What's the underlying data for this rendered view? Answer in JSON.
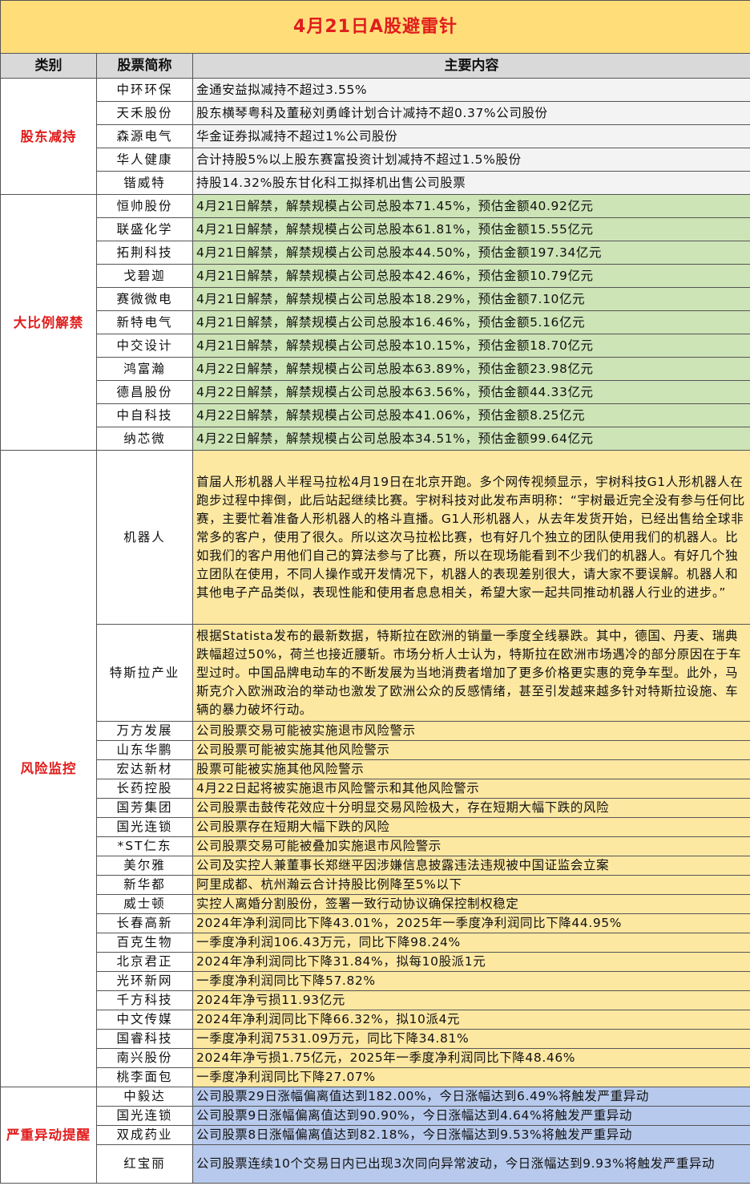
{
  "title": "4月21日A股避雷针",
  "headers": {
    "category": "类别",
    "name": "股票简称",
    "content": "主要内容"
  },
  "sections": [
    {
      "category": "股东减持",
      "theme": "gray",
      "rows": [
        {
          "name": "中环环保",
          "content": "金通安益拟减持不超过3.55%",
          "h": 29
        },
        {
          "name": "天禾股份",
          "content": "股东横琴粤科及董秘刘勇峰计划合计减持不超0.37%公司股份",
          "h": 29
        },
        {
          "name": "森源电气",
          "content": "华金证券拟减持不超过1%公司股份",
          "h": 29
        },
        {
          "name": "华人健康",
          "content": "合计持股5%以上股东赛富投资计划减持不超过1.5%股份",
          "h": 29
        },
        {
          "name": "锴威特",
          "content": "持股14.32%股东甘化科工拟择机出售公司股票",
          "h": 29
        }
      ]
    },
    {
      "category": "大比例解禁",
      "theme": "green",
      "rows": [
        {
          "name": "恒帅股份",
          "content": "4月21日解禁，解禁规模占公司总股本71.45%，预估金额40.92亿元",
          "h": 29
        },
        {
          "name": "联盛化学",
          "content": "4月21日解禁，解禁规模占公司总股本61.81%，预估金额15.55亿元",
          "h": 29
        },
        {
          "name": "拓荆科技",
          "content": "4月21日解禁，解禁规模占公司总股本44.50%，预估金额197.34亿元",
          "h": 29
        },
        {
          "name": "戈碧迦",
          "content": "4月21日解禁，解禁规模占公司总股本42.46%，预估金额10.79亿元",
          "h": 29
        },
        {
          "name": "赛微微电",
          "content": "4月21日解禁，解禁规模占公司总股本18.29%，预估金额7.10亿元",
          "h": 29
        },
        {
          "name": "新特电气",
          "content": "4月21日解禁，解禁规模占公司总股本16.46%，预估金额5.16亿元",
          "h": 29
        },
        {
          "name": "中交设计",
          "content": "4月21日解禁，解禁规模占公司总股本10.15%，预估金额18.70亿元",
          "h": 29
        },
        {
          "name": "鸿富瀚",
          "content": "4月22日解禁，解禁规模占公司总股本63.89%，预估金额23.98亿元",
          "h": 29
        },
        {
          "name": "德昌股份",
          "content": "4月22日解禁，解禁规模占公司总股本63.56%，预估金额44.33亿元",
          "h": 29
        },
        {
          "name": "中自科技",
          "content": "4月22日解禁，解禁规模占公司总股本41.06%，预估金额8.25亿元",
          "h": 29
        },
        {
          "name": "纳芯微",
          "content": "4月22日解禁，解禁规模占公司总股本34.51%，预估金额99.64亿元",
          "h": 29
        }
      ]
    },
    {
      "category": "风险监控",
      "theme": "yellow",
      "rows": [
        {
          "name": "机器人",
          "content": "首届人形机器人半程马拉松4月19日在北京开跑。多个网传视频显示，宇树科技G1人形机器人在跑步过程中摔倒，此后站起继续比赛。宇树科技对此发布声明称：“宇树最近完全没有参与任何比赛，主要忙着准备人形机器人的格斗直播。G1人形机器人，从去年发货开始，已经出售给全球非常多的客户，使用了很久。所以这次马拉松比赛，也有好几个独立的团队使用我们的机器人。比如我们的客户用他们自己的算法参与了比赛，所以在现场能看到不少我们的机器人。有好几个独立团队在使用，不同人操作或开发情况下，机器人的表现差别很大，请大家不要误解。机器人和其他电子产品类似，表现性能和使用者息息相关，希望大家一起共同推动机器人行业的进步。”",
          "h": 217,
          "wrap": true
        },
        {
          "name": "特斯拉产业",
          "content": "根据Statista发布的最新数据，特斯拉在欧洲的销量一季度全线暴跌。其中，德国、丹麦、瑞典跌幅超过50%，荷兰也接近腰斩。市场分析人士认为，特斯拉在欧洲市场遇冷的部分原因在于车型过时。中国品牌电动车的不断发展为当地消费者增加了更多价格更实惠的竞争车型。此外，马斯克介入欧洲政治的举动也激发了欧洲公众的反感情绪，甚至引发越来越多针对特斯拉设施、车辆的暴力破坏行动。",
          "h": 121,
          "wrap": true
        },
        {
          "name": "万方发展",
          "content": "公司股票交易可能被实施退市风险警示",
          "h": 24
        },
        {
          "name": "山东华鹏",
          "content": "公司股票可能被实施其他风险警示",
          "h": 24
        },
        {
          "name": "宏达新材",
          "content": "股票可能被实施其他风险警示",
          "h": 24
        },
        {
          "name": "长药控股",
          "content": "4月22日起将被实施退市风险警示和其他风险警示",
          "h": 24
        },
        {
          "name": "国芳集团",
          "content": "公司股票击鼓传花效应十分明显交易风险极大，存在短期大幅下跌的风险",
          "h": 24
        },
        {
          "name": "国光连锁",
          "content": "公司股票存在短期大幅下跌的风险",
          "h": 24
        },
        {
          "name": "*ST仁东",
          "content": "公司股票交易可能被叠加实施退市风险警示",
          "h": 24
        },
        {
          "name": "美尔雅",
          "content": "公司及实控人兼董事长郑继平因涉嫌信息披露违法违规被中国证监会立案",
          "h": 24
        },
        {
          "name": "新华都",
          "content": "阿里成都、杭州瀚云合计持股比例降至5%以下",
          "h": 24
        },
        {
          "name": "威士顿",
          "content": "实控人离婚分割股份，签署一致行动协议确保控制权稳定",
          "h": 24
        },
        {
          "name": "长春高新",
          "content": "2024年净利润同比下降43.01%，2025年一季度净利润同比下降44.95%",
          "h": 24
        },
        {
          "name": "百克生物",
          "content": "一季度净利润106.43万元，同比下降98.24%",
          "h": 24
        },
        {
          "name": "北京君正",
          "content": "2024年净利润同比下降31.84%，拟每10股派1元",
          "h": 24
        },
        {
          "name": "光环新网",
          "content": "一季度净利润同比下降57.82%",
          "h": 24
        },
        {
          "name": "千方科技",
          "content": "2024年净亏损11.93亿元",
          "h": 24
        },
        {
          "name": "中文传媒",
          "content": "2024年净利润同比下降66.32%，拟10派4元",
          "h": 24
        },
        {
          "name": "国睿科技",
          "content": "一季度净利润7531.09万元，同比下降34.81%",
          "h": 24
        },
        {
          "name": "南兴股份",
          "content": "2024年净亏损1.75亿元，2025年一季度净利润同比下降48.46%",
          "h": 24
        },
        {
          "name": "桃李面包",
          "content": "一季度净利润同比下降27.07%",
          "h": 24
        }
      ]
    },
    {
      "category": "严重异动提醒",
      "theme": "blue",
      "rows": [
        {
          "name": "中毅达",
          "content": "公司股票29日涨幅偏离值达到182.00%，今日涨幅达到6.49%将触发严重异动",
          "h": 24
        },
        {
          "name": "国光连锁",
          "content": "公司股票9日涨幅偏离值达到90.90%，今日涨幅达到4.64%将触发严重异动",
          "h": 24
        },
        {
          "name": "双成药业",
          "content": "公司股票8日涨幅偏离值达到82.18%，今日涨幅达到9.53%将触发严重异动",
          "h": 24
        },
        {
          "name": "红宝丽",
          "content": "公司股票连续10个交易日内已出现3次同向异常波动，今日涨幅达到9.93%将触发严重异动",
          "h": 48,
          "wrap": true
        }
      ]
    }
  ]
}
